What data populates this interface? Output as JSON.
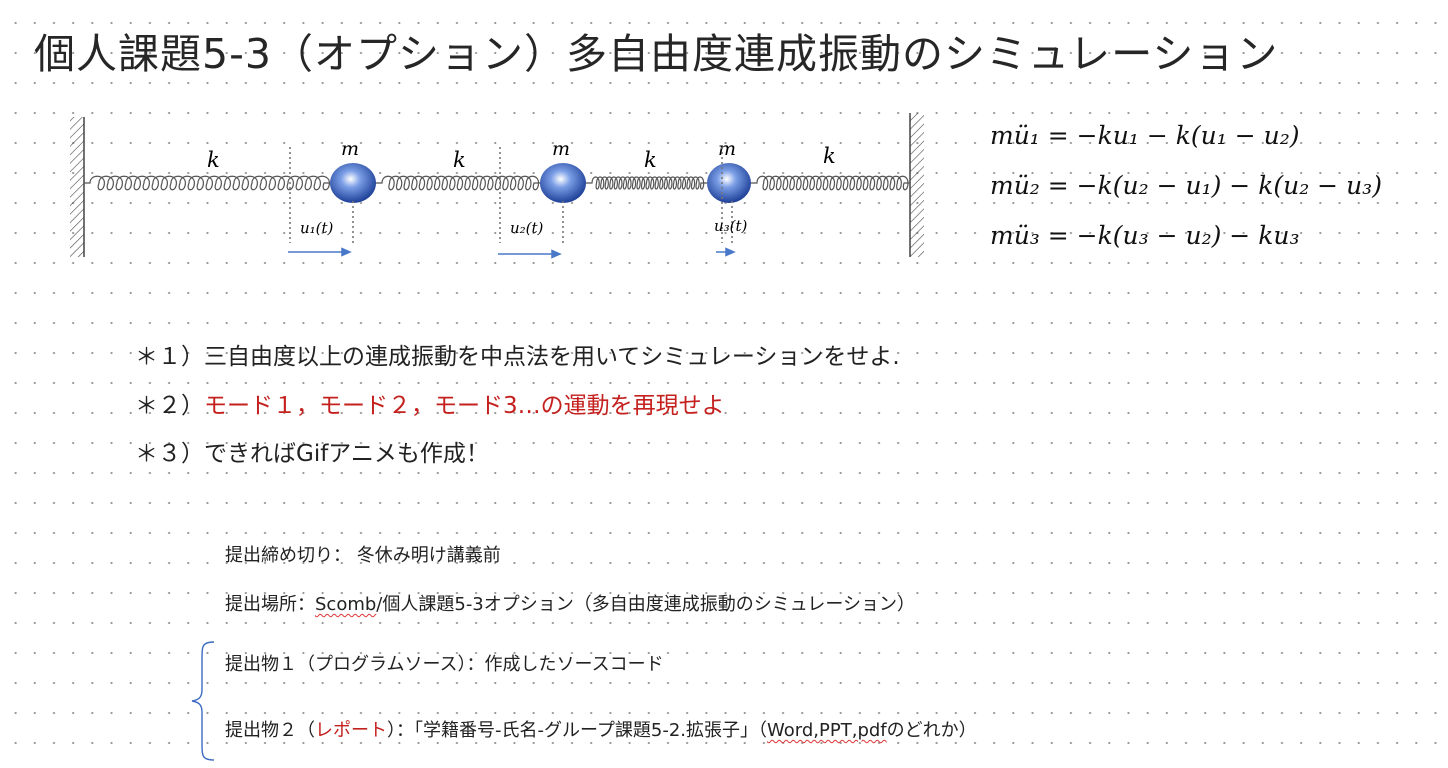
{
  "title": "個人課題5-3（オプション）多自由度連成振動のシミュレーション",
  "diagram": {
    "spring_labels": [
      "k",
      "k",
      "k",
      "k"
    ],
    "mass_labels": [
      "m",
      "m",
      "m"
    ],
    "displacement_labels": [
      "u₁(t)",
      "u₂(t)",
      "u₃(t)"
    ],
    "mass_color": "#2f59b8",
    "arrow_color": "#4a78c8"
  },
  "equations": [
    "mü₁ = −ku₁ − k(u₁ − u₂)",
    "mü₂ = −k(u₂ − u₁) − k(u₂ − u₃)",
    "mü₃ = −k(u₃ − u₂) − ku₃"
  ],
  "bullets": {
    "b1": {
      "prefix": "＊１）",
      "text": "三自由度以上の連成振動を中点法を用いてシミュレーションをせよ."
    },
    "b2": {
      "prefix": "＊２）",
      "red_text": "モード１，モード２，モード3…の運動を再現せよ"
    },
    "b3": {
      "prefix": "＊３）",
      "text": "できればGifアニメも作成！"
    }
  },
  "submission": {
    "deadline": "提出締め切り：  冬休み明け講義前",
    "place_prefix": "提出場所：",
    "place_link": "Scomb",
    "place_rest": "/個人課題5-3オプション（多自由度連成振動のシミュレーション）",
    "item1": "提出物１（プログラムソース）：作成したソースコード",
    "item2_prefix": "提出物２（",
    "item2_red": "レポート",
    "item2_mid": "）：「学籍番号-氏名-グループ課題5-2.拡張子」（",
    "item2_under": "Word,PPT,pdf",
    "item2_end": "のどれか）"
  },
  "accent_red": "#c4201e"
}
